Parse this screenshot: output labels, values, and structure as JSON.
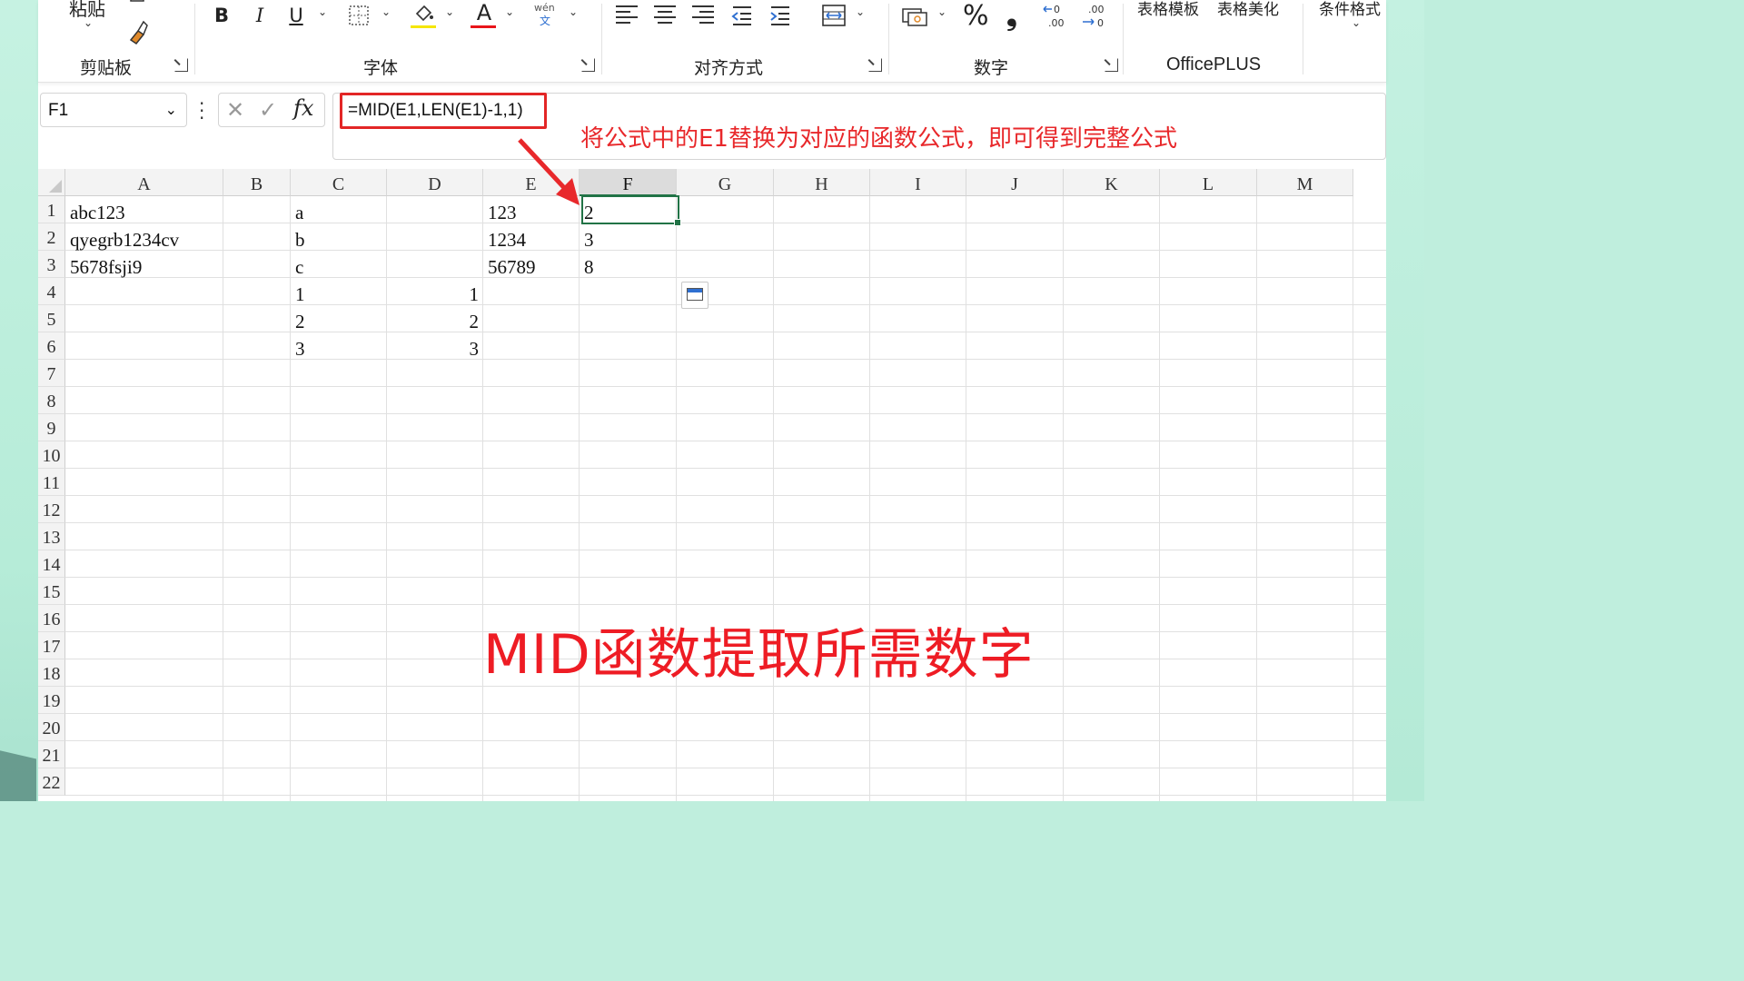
{
  "ribbon": {
    "clipboard": {
      "paste_label": "粘贴",
      "group_label": "剪贴板"
    },
    "font": {
      "bold": "B",
      "italic": "I",
      "underline": "U",
      "font_color_glyph": "A",
      "phonetic_top": "wén",
      "phonetic_bottom": "文",
      "group_label": "字体"
    },
    "alignment": {
      "group_label": "对齐方式"
    },
    "number": {
      "percent": "%",
      "comma": "❟",
      "group_label": "数字"
    },
    "templates": {
      "table_template": "表格模板",
      "table_beautify": "表格美化",
      "group_label": "OfficePLUS"
    },
    "styles": {
      "conditional_format": "条件格式"
    },
    "colors": {
      "highlight": "#f5e600",
      "font_color": "#e8141a",
      "accent": "#217346"
    }
  },
  "formula_bar": {
    "name_box": "F1",
    "fx_label": "fx",
    "formula": "=MID(E1,LEN(E1)-1,1)"
  },
  "annotation": "将公式中的E1替换为对应的函数公式，即可得到完整公式",
  "caption": "MID函数提取所需数字",
  "sheet": {
    "columns": [
      "A",
      "B",
      "C",
      "D",
      "E",
      "F",
      "G",
      "H",
      "I",
      "J",
      "K",
      "L",
      "M"
    ],
    "rows": [
      "1",
      "2",
      "3",
      "4",
      "5",
      "6",
      "7",
      "8",
      "9",
      "10",
      "11",
      "12",
      "13",
      "14",
      "15",
      "16",
      "17",
      "18",
      "19",
      "20",
      "21",
      "22"
    ],
    "selected_column": "F",
    "active_cell": "F1",
    "cells": {
      "A1": "abc123",
      "C1": "a",
      "E1": "123",
      "F1": "2",
      "A2": "qyegrb1234cv",
      "C2": "b",
      "E2": "1234",
      "F2": "3",
      "A3": "5678fsji9",
      "C3": "c",
      "E3": "56789",
      "F3": "8",
      "C4": "1",
      "D4": "1",
      "C5": "2",
      "D5": "2",
      "C6": "3",
      "D6": "3"
    }
  }
}
